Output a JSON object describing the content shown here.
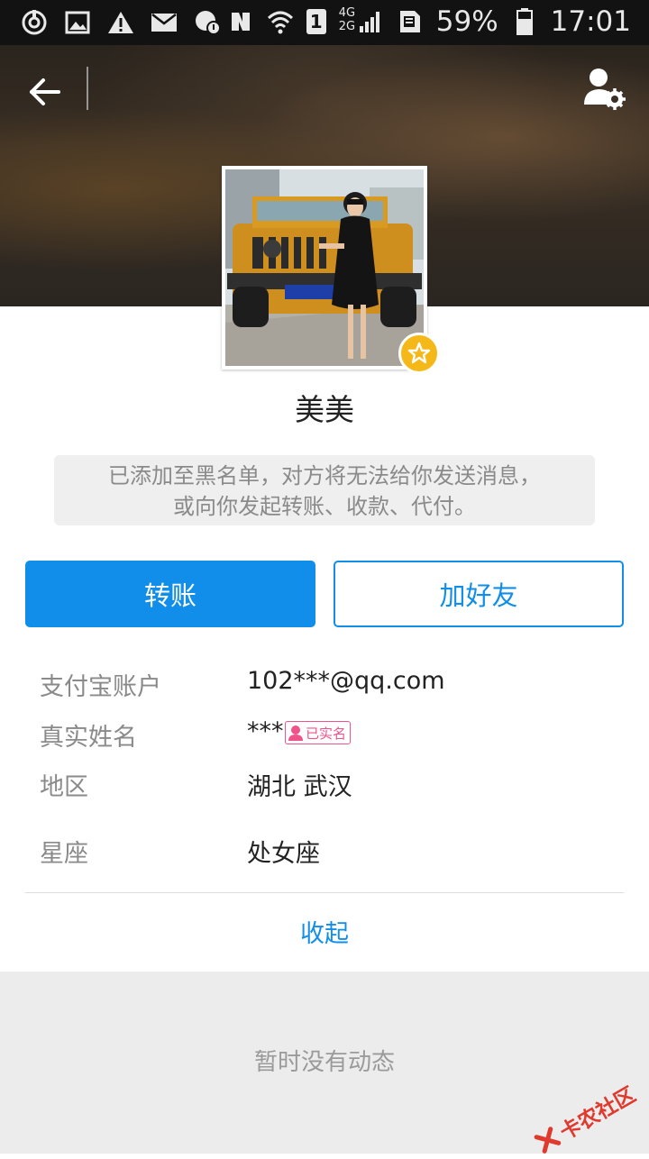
{
  "status_bar": {
    "battery": "59%",
    "time": "17:01",
    "network_top": "4G",
    "network_bottom": "2G",
    "sim": "1",
    "icons": [
      "sync-icon",
      "gallery-icon",
      "warning-icon",
      "mail-icon",
      "chat-icon",
      "nfc-icon",
      "wifi-icon",
      "sim-icon",
      "signal-icon",
      "storage-icon",
      "battery-icon"
    ]
  },
  "header": {
    "back_icon": "back-arrow-icon",
    "settings_icon": "user-settings-icon"
  },
  "profile": {
    "name": "美美",
    "badge_icon": "star-icon"
  },
  "notice": {
    "line1": "已添加至黑名单，对方将无法给你发送消息，",
    "line2": "或向你发起转账、收款、代付。"
  },
  "actions": {
    "transfer": "转账",
    "add_friend": "加好友"
  },
  "info": {
    "account_label": "支付宝账户",
    "account_value": "102***@qq.com",
    "realname_label": "真实姓名",
    "realname_value": "***",
    "verified_badge": "已实名",
    "region_label": "地区",
    "region_value": "湖北 武汉",
    "zodiac_label": "星座",
    "zodiac_value": "处女座"
  },
  "collapse_label": "收起",
  "feed": {
    "empty_text": "暂时没有动态"
  },
  "watermark": "卡农社区",
  "colors": {
    "accent": "#108ee9",
    "badge": "#f0528a",
    "star": "#f5b819"
  }
}
